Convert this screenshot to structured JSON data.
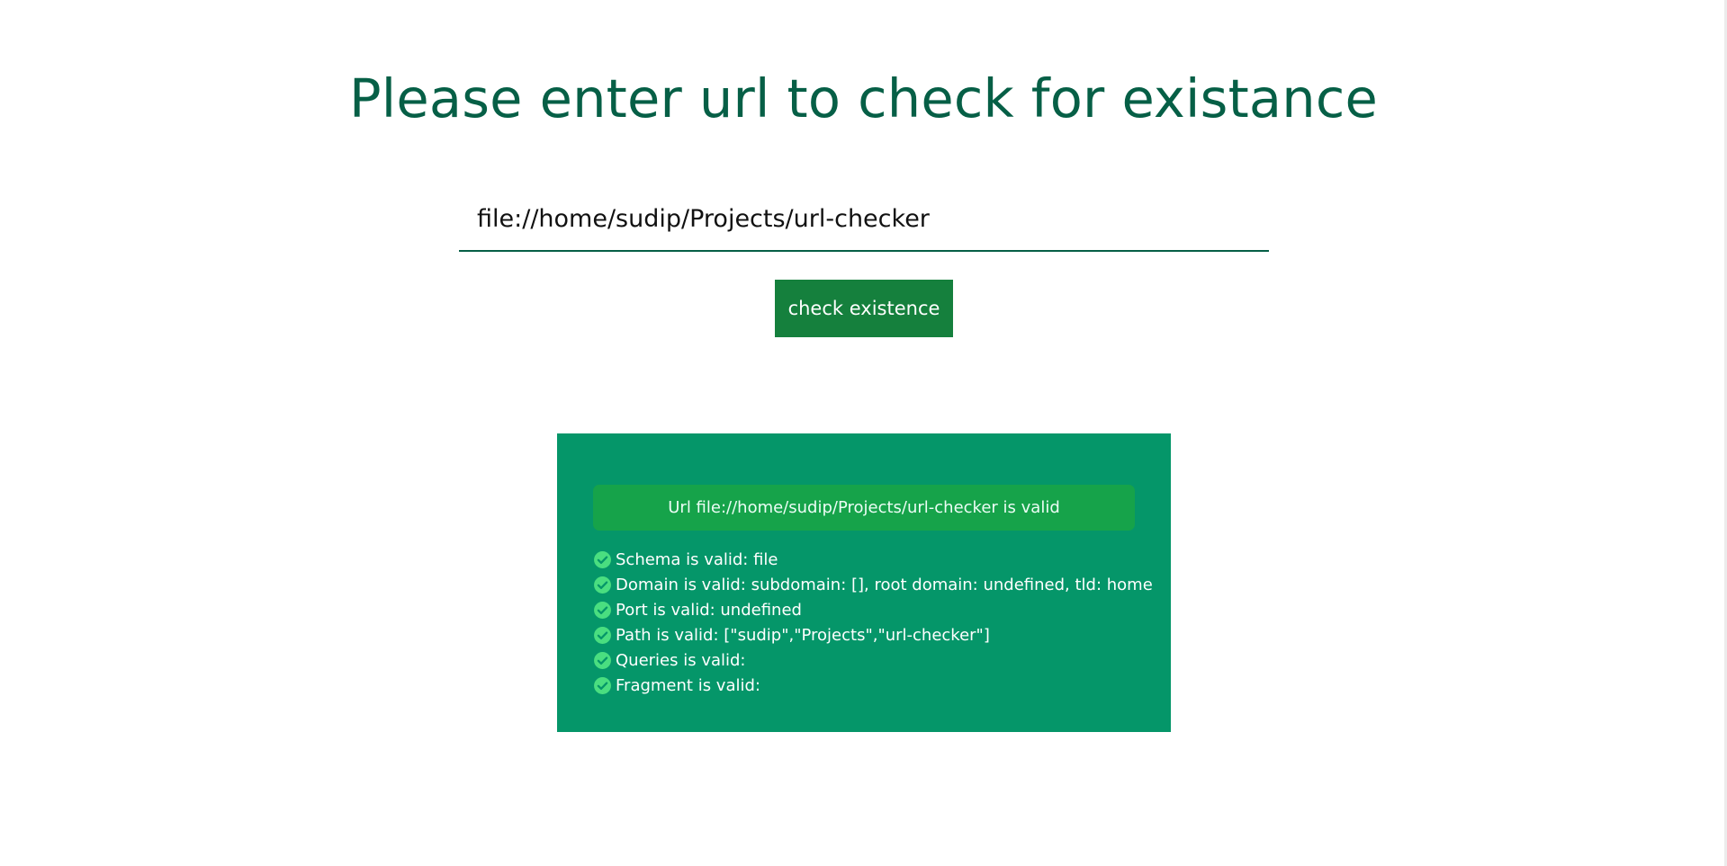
{
  "header": {
    "title": "Please enter url to check for existance"
  },
  "form": {
    "url_value": "file://home/sudip/Projects/url-checker",
    "submit_label": "check existence"
  },
  "result": {
    "banner": "Url file://home/sudip/Projects/url-checker is valid",
    "checks": [
      {
        "icon": "check-circle-icon",
        "text": "Schema is valid: file"
      },
      {
        "icon": "check-circle-icon",
        "text": "Domain is valid: subdomain: [], root domain: undefined, tld: home"
      },
      {
        "icon": "check-circle-icon",
        "text": "Port is valid: undefined"
      },
      {
        "icon": "check-circle-icon",
        "text": "Path is valid: [\"sudip\",\"Projects\",\"url-checker\"]"
      },
      {
        "icon": "check-circle-icon",
        "text": "Queries is valid:"
      },
      {
        "icon": "check-circle-icon",
        "text": "Fragment is valid:"
      }
    ]
  },
  "colors": {
    "title": "#065f46",
    "button": "#15803d",
    "panel": "#059669",
    "banner": "#16a34a",
    "check_icon": "#4ade80"
  }
}
